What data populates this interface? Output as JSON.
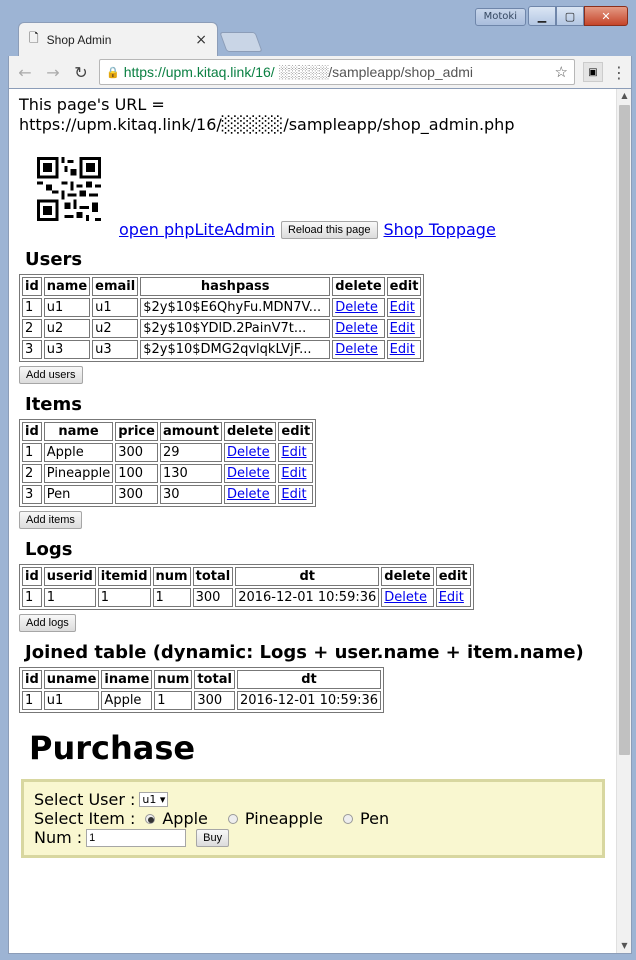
{
  "window": {
    "profile_name": "Motoki"
  },
  "tab": {
    "title": "Shop Admin"
  },
  "address_bar": {
    "secure_part": "https://upm.kitaq.link/16/",
    "rest": "░░░░░/sampleapp/shop_admi"
  },
  "page": {
    "url_label": "This page's URL =",
    "url_value": "https://upm.kitaq.link/16/░░░░░/sampleapp/shop_admin.php",
    "open_phplite": "open phpLiteAdmin",
    "reload": "Reload this page",
    "shop_top": "Shop Toppage"
  },
  "users": {
    "heading": "Users",
    "headers": [
      "id",
      "name",
      "email",
      "hashpass",
      "delete",
      "edit"
    ],
    "rows": [
      [
        "1",
        "u1",
        "u1",
        "$2y$10$E6QhyFu.MDN7V...",
        "Delete",
        "Edit"
      ],
      [
        "2",
        "u2",
        "u2",
        "$2y$10$YDlD.2PainV7t...",
        "Delete",
        "Edit"
      ],
      [
        "3",
        "u3",
        "u3",
        "$2y$10$DMG2qvlqkLVjF...",
        "Delete",
        "Edit"
      ]
    ],
    "add_label": "Add users"
  },
  "items": {
    "heading": "Items",
    "headers": [
      "id",
      "name",
      "price",
      "amount",
      "delete",
      "edit"
    ],
    "rows": [
      [
        "1",
        "Apple",
        "300",
        "29",
        "Delete",
        "Edit"
      ],
      [
        "2",
        "Pineapple",
        "100",
        "130",
        "Delete",
        "Edit"
      ],
      [
        "3",
        "Pen",
        "300",
        "30",
        "Delete",
        "Edit"
      ]
    ],
    "add_label": "Add items"
  },
  "logs": {
    "heading": "Logs",
    "headers": [
      "id",
      "userid",
      "itemid",
      "num",
      "total",
      "dt",
      "delete",
      "edit"
    ],
    "rows": [
      [
        "1",
        "1",
        "1",
        "1",
        "300",
        "2016-12-01 10:59:36",
        "Delete",
        "Edit"
      ]
    ],
    "add_label": "Add logs"
  },
  "joined": {
    "heading": "Joined table (dynamic: Logs + user.name + item.name)",
    "headers": [
      "id",
      "uname",
      "iname",
      "num",
      "total",
      "dt"
    ],
    "rows": [
      [
        "1",
        "u1",
        "Apple",
        "1",
        "300",
        "2016-12-01 10:59:36"
      ]
    ]
  },
  "purchase": {
    "heading": "Purchase",
    "select_user_label": "Select User :",
    "user_selected": "u1 ▾",
    "select_item_label": "Select Item :",
    "items": [
      {
        "label": "Apple",
        "checked": true
      },
      {
        "label": "Pineapple",
        "checked": false
      },
      {
        "label": "Pen",
        "checked": false
      }
    ],
    "num_label": "Num :",
    "num_value": "1",
    "buy_label": "Buy"
  }
}
